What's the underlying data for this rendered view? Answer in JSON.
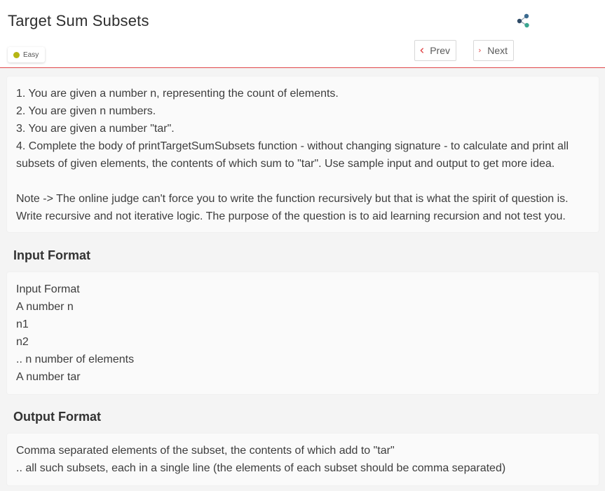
{
  "header": {
    "title": "Target Sum Subsets",
    "difficulty": "Easy",
    "prev_label": "Prev",
    "next_label": "Next",
    "share_icon": "share-icon",
    "accent_color": "#e0484a",
    "difficulty_color": "#b5b514"
  },
  "description": {
    "lines": [
      "1. You are given a number n, representing the count of elements.",
      "2. You are given n numbers.",
      "3. You are given a number \"tar\".",
      "4. Complete the body of printTargetSumSubsets function - without changing signature - to calculate and print all subsets of given elements, the contents of which sum to \"tar\". Use sample input and output to get more idea."
    ],
    "note": "Note -> The online judge can't force you to write the function recursively but that is what the spirit of question is. Write recursive and not iterative logic. The purpose of the question is to aid learning recursion and not test you."
  },
  "input_format": {
    "title": "Input Format",
    "lines": [
      "Input Format",
      "A number n",
      "n1",
      "n2",
      ".. n number of elements",
      "A number tar"
    ]
  },
  "output_format": {
    "title": "Output Format",
    "lines": [
      "Comma separated elements of the subset, the contents of which add to \"tar\"",
      ".. all such subsets, each in a single line (the elements of each subset should be comma separated)"
    ]
  }
}
